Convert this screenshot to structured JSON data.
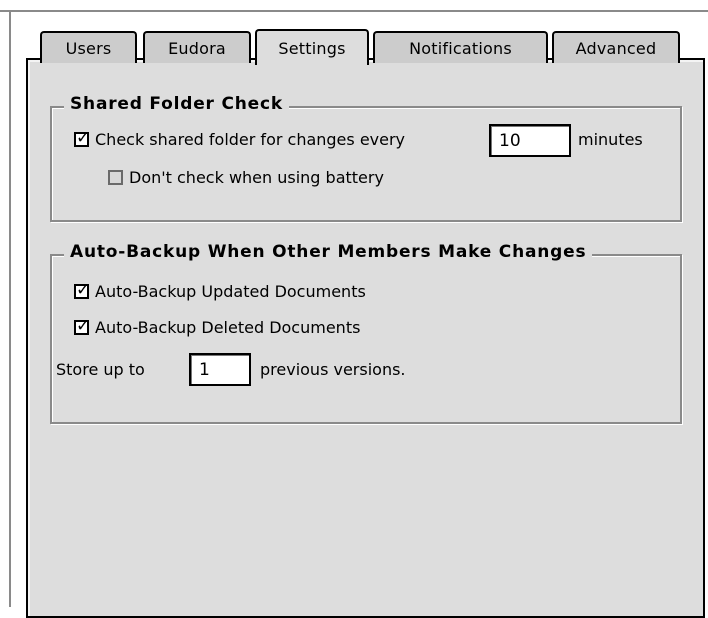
{
  "tabs": [
    {
      "label": "Users"
    },
    {
      "label": "Eudora"
    },
    {
      "label": "Settings",
      "active": true
    },
    {
      "label": "Notifications"
    },
    {
      "label": "Advanced"
    }
  ],
  "shared_folder": {
    "title": "Shared Folder Check",
    "check_label": "Check shared folder for changes every",
    "check_checked": true,
    "minutes_value": "10",
    "minutes_label": "minutes",
    "battery_label": "Don't check when using battery",
    "battery_checked": false
  },
  "auto_backup": {
    "title": "Auto-Backup When Other Members Make Changes",
    "updated_label": "Auto-Backup Updated Documents",
    "updated_checked": true,
    "deleted_label": "Auto-Backup Deleted Documents",
    "deleted_checked": true,
    "store_prefix": "Store up to",
    "versions_value": "1",
    "store_suffix": "previous versions."
  },
  "colors": {
    "panel": "#dddddd",
    "frame": "#8a8a8a",
    "text": "#000000"
  }
}
